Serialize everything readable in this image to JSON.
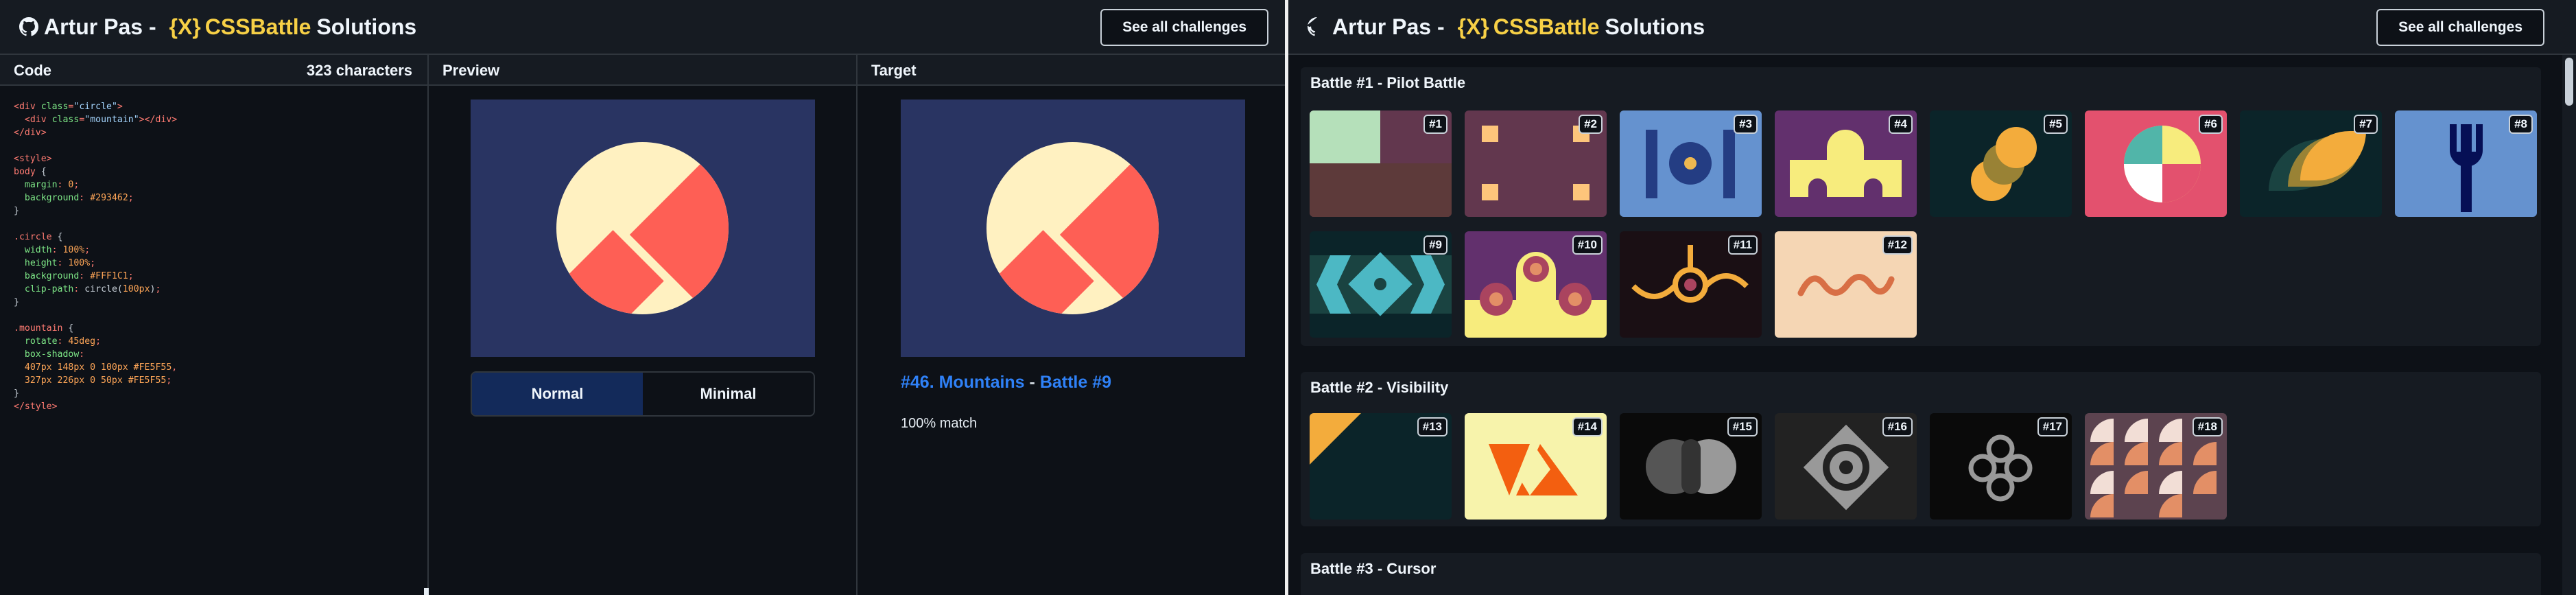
{
  "left": {
    "brand": {
      "name": "Artur Pas",
      "dash": " - ",
      "x_icon": "{X}",
      "css": "CSSBattle",
      "solutions": "Solutions"
    },
    "see_all": "See all challenges",
    "code_label": "Code",
    "char_count": "323 characters",
    "preview_label": "Preview",
    "target_label": "Target",
    "toggle": {
      "normal": "Normal",
      "minimal": "Minimal"
    },
    "target": {
      "challenge": "#46. Mountains",
      "sep": " - ",
      "battle": "Battle #9",
      "match": "100% match"
    },
    "colors": {
      "bg": "#293462",
      "circle": "#FFF1C1",
      "mountain": "#FE5F55"
    }
  },
  "right": {
    "brand": {
      "name": "Artur Pas",
      "dash": " - ",
      "x_icon": "{X}",
      "css": "CSSBattle",
      "solutions": "Solutions"
    },
    "see_all": "See all challenges",
    "sections": [
      {
        "title": "Battle #1 - Pilot Battle",
        "tiles": [
          "#1",
          "#2",
          "#3",
          "#4",
          "#5",
          "#6",
          "#7",
          "#8",
          "#9",
          "#10",
          "#11",
          "#12"
        ]
      },
      {
        "title": "Battle #2 - Visibility",
        "tiles": [
          "#13",
          "#14",
          "#15",
          "#16",
          "#17",
          "#18"
        ]
      },
      {
        "title": "Battle #3 - Cursor",
        "tiles": []
      }
    ]
  }
}
